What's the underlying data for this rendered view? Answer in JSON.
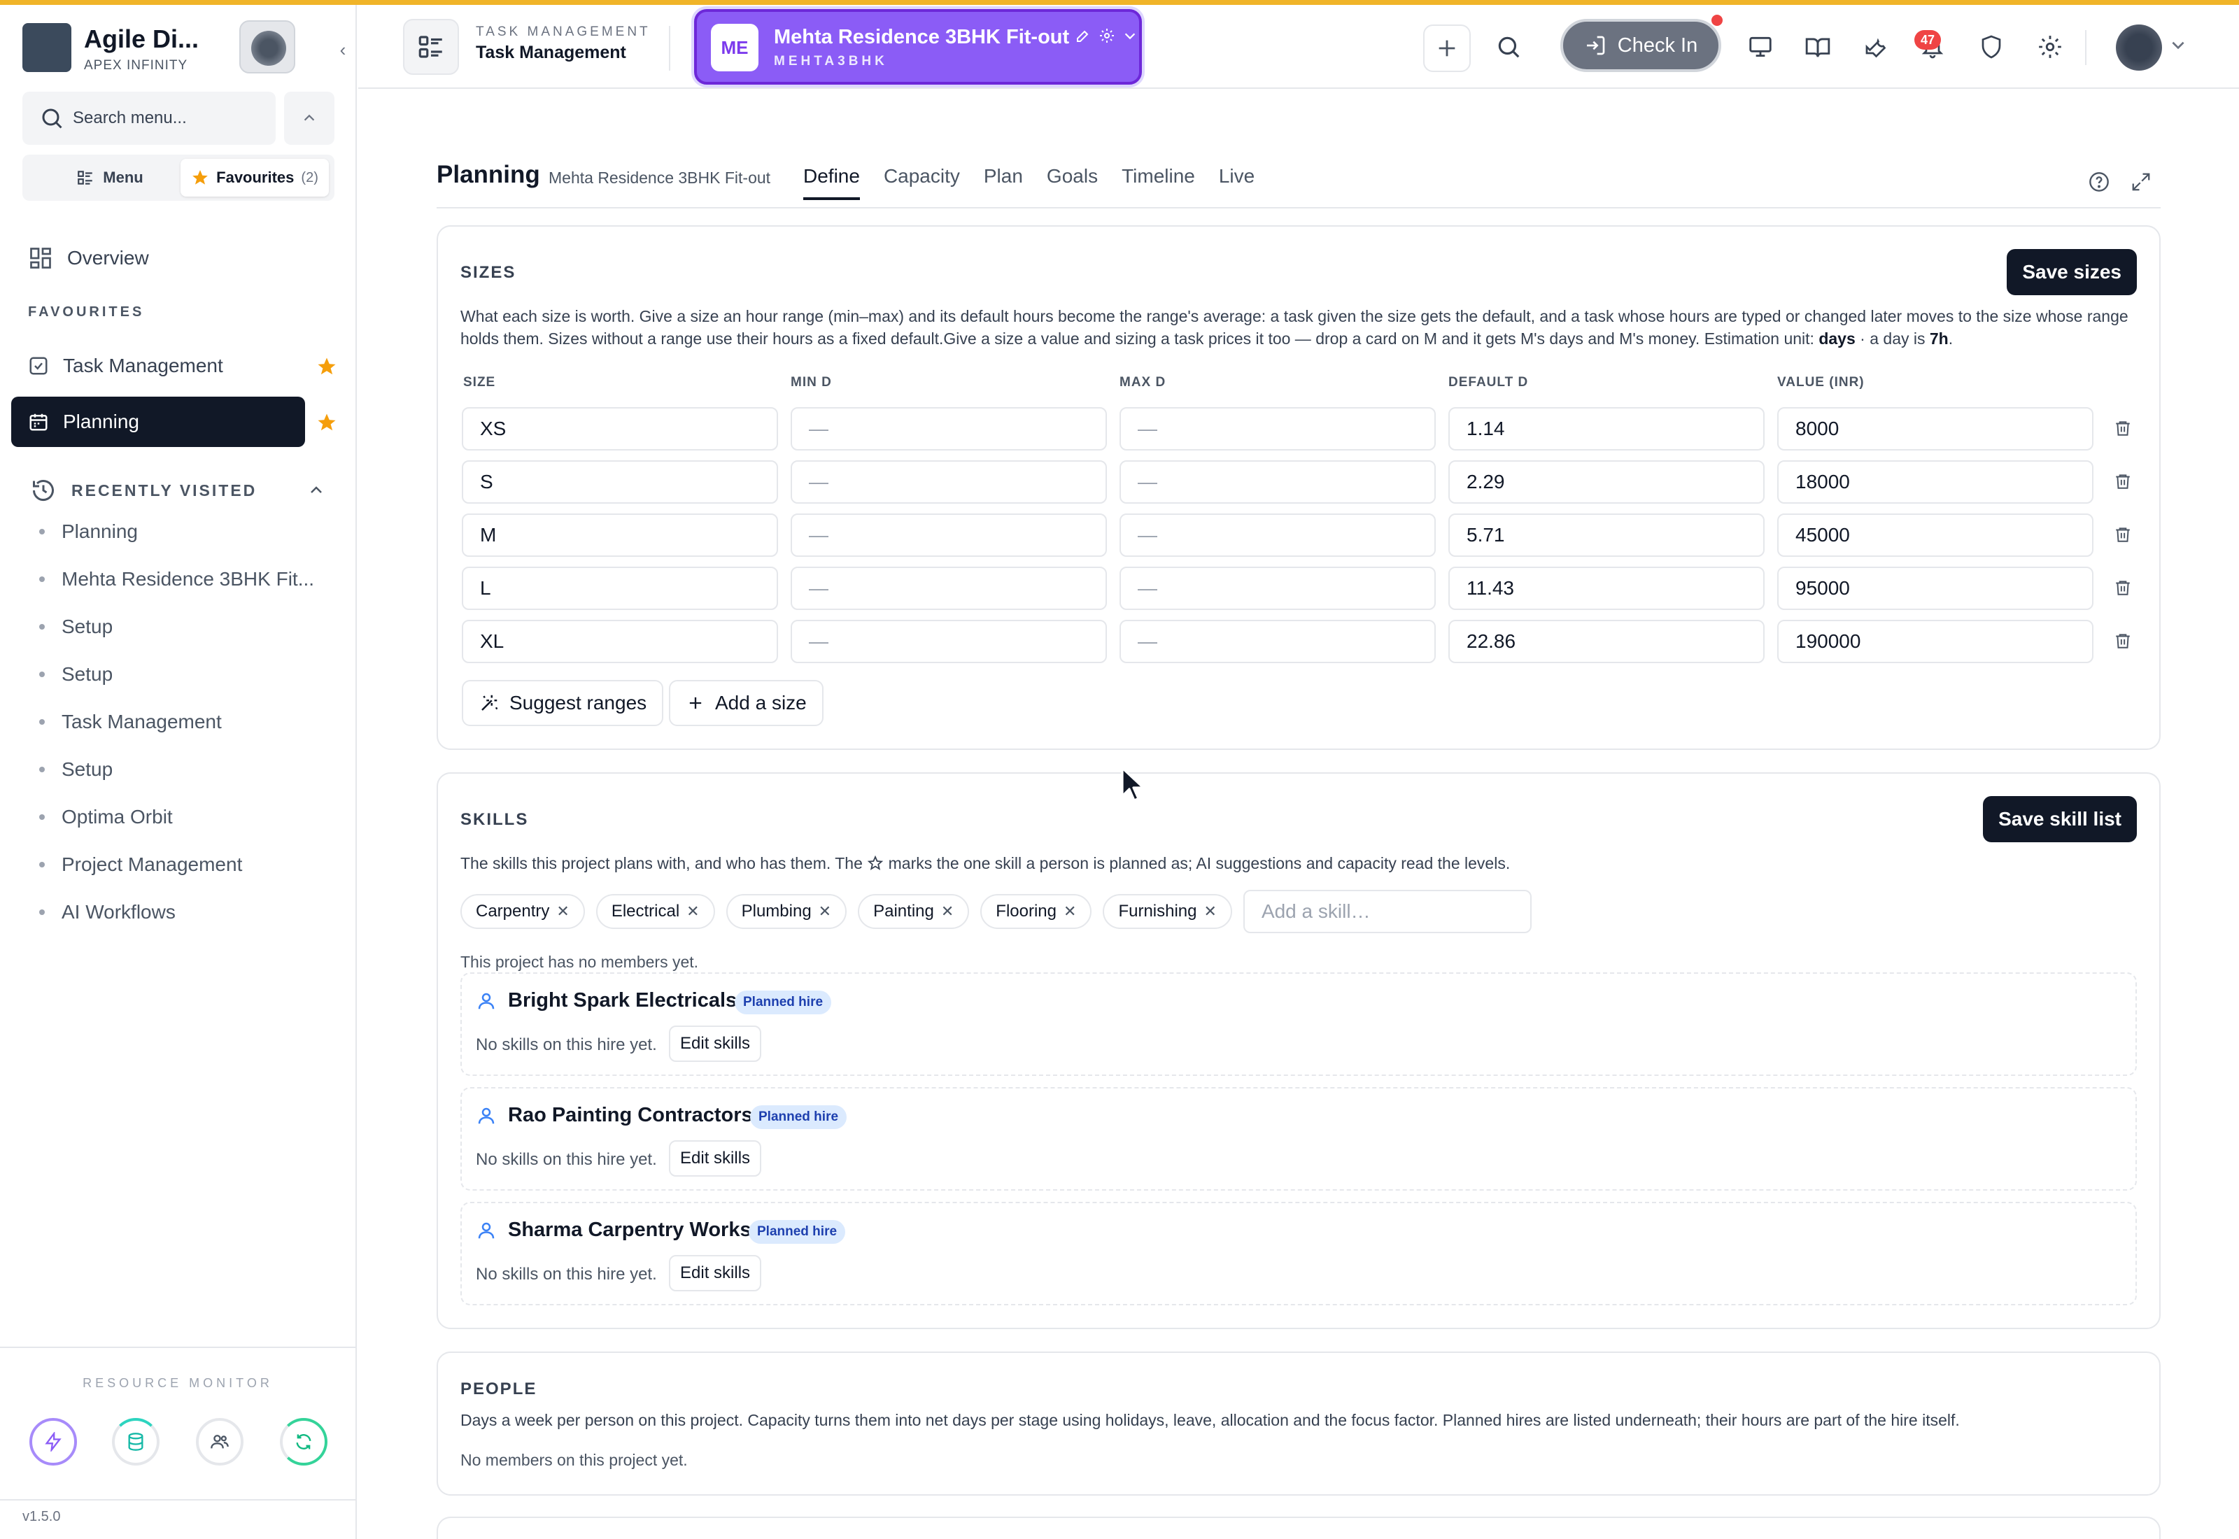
{
  "sidebar": {
    "brand_name": "Agile Di...",
    "brand_org": "APEX INFINITY",
    "search_placeholder": "Search menu...",
    "tab_menu": "Menu",
    "tab_favourites": "Favourites",
    "favourites_count": "(2)",
    "overview": "Overview",
    "favourites_label": "FAVOURITES",
    "favourites": [
      {
        "label": "Task Management"
      },
      {
        "label": "Planning"
      }
    ],
    "recent_label": "RECENTLY VISITED",
    "recent": [
      {
        "label": "Planning"
      },
      {
        "label": "Mehta Residence 3BHK Fit..."
      },
      {
        "label": "Setup"
      },
      {
        "label": "Setup"
      },
      {
        "label": "Task Management"
      },
      {
        "label": "Setup"
      },
      {
        "label": "Optima Orbit"
      },
      {
        "label": "Project Management"
      },
      {
        "label": "AI Workflows"
      }
    ],
    "monitor_label": "RESOURCE MONITOR",
    "version": "v1.5.0"
  },
  "header": {
    "app_eyebrow": "TASK MANAGEMENT",
    "app_title": "Task Management",
    "project_avatar": "ME",
    "project_name": "Mehta Residence 3BHK Fit-out",
    "project_code": "MEHTA3BHK",
    "checkin_label": "Check In",
    "notification_count": "47"
  },
  "page": {
    "title": "Planning",
    "subtitle": "Mehta Residence 3BHK Fit-out",
    "tabs": [
      "Define",
      "Capacity",
      "Plan",
      "Goals",
      "Timeline",
      "Live"
    ],
    "active_tab": "Define"
  },
  "sizes": {
    "title": "SIZES",
    "save_label": "Save sizes",
    "desc_main": "What each size is worth. Give a size an hour range (min–max) and its default hours become the range's average: a task given the size gets the default, and a task whose hours are typed or changed later moves to the size whose range holds them. Sizes without a range use their hours as a fixed default.Give a size a value and sizing a task prices it too — drop a card on M and it gets M's days and M's money. Estimation unit: ",
    "desc_unit": "days",
    "desc_mid": " · a day is ",
    "desc_hours": "7h",
    "desc_end": ".",
    "columns": [
      "SIZE",
      "MIN D",
      "MAX D",
      "DEFAULT D",
      "VALUE (INR)"
    ],
    "empty_placeholder": "—",
    "rows": [
      {
        "size": "XS",
        "default": "1.14",
        "value": "8000"
      },
      {
        "size": "S",
        "default": "2.29",
        "value": "18000"
      },
      {
        "size": "M",
        "default": "5.71",
        "value": "45000"
      },
      {
        "size": "L",
        "default": "11.43",
        "value": "95000"
      },
      {
        "size": "XL",
        "default": "22.86",
        "value": "190000"
      }
    ],
    "suggest_label": "Suggest ranges",
    "add_label": "Add a size"
  },
  "skills": {
    "title": "SKILLS",
    "save_label": "Save skill list",
    "desc_before": "The skills this project plans with, and who has them. The ",
    "desc_after": " marks the one skill a person is planned as; AI suggestions and capacity read the levels.",
    "chips": [
      "Carpentry",
      "Electrical",
      "Plumbing",
      "Painting",
      "Flooring",
      "Furnishing"
    ],
    "add_placeholder": "Add a skill…",
    "no_members": "This project has no members yet.",
    "hires": [
      {
        "name": "Bright Spark Electricals",
        "badge": "Planned hire",
        "note": "No skills on this hire yet.",
        "edit": "Edit skills"
      },
      {
        "name": "Rao Painting Contractors",
        "badge": "Planned hire",
        "note": "No skills on this hire yet.",
        "edit": "Edit skills"
      },
      {
        "name": "Sharma Carpentry Works",
        "badge": "Planned hire",
        "note": "No skills on this hire yet.",
        "edit": "Edit skills"
      }
    ]
  },
  "people": {
    "title": "PEOPLE",
    "desc": "Days a week per person on this project. Capacity turns them into net days per stage using holidays, leave, allocation and the focus factor. Planned hires are listed underneath; their hours are part of the hire itself.",
    "empty": "No members on this project yet."
  },
  "colors": {
    "accent_purple": "#8b5cf6",
    "dark": "#111827",
    "star": "#f59e0b",
    "top_line": "#f0b429"
  }
}
